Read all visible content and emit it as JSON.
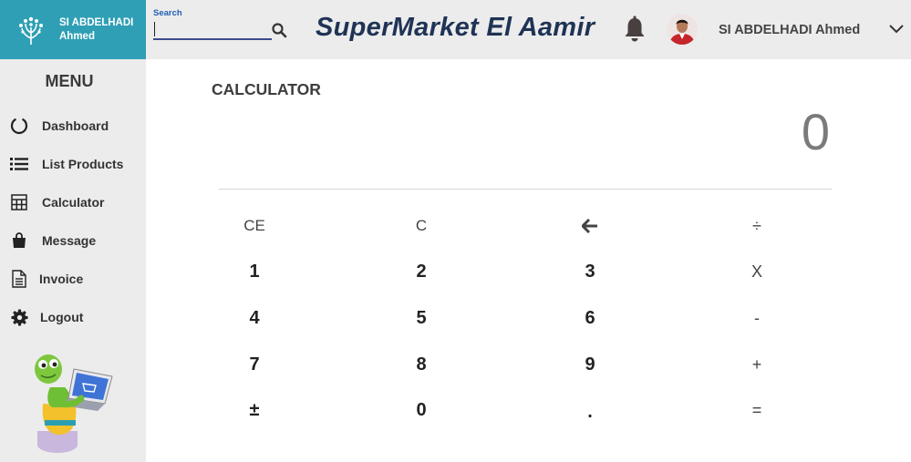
{
  "brand": {
    "user_line1": "SI ABDELHADI",
    "user_line2": "Ahmed",
    "color": "#2f9fb5"
  },
  "header": {
    "search_label": "Search",
    "search_value": "",
    "app_title": "SuperMarket El Aamir",
    "user_name": "SI ABDELHADI Ahmed",
    "icons": [
      "search-icon",
      "bell-icon",
      "chevron-down-icon"
    ]
  },
  "sidebar": {
    "title": "MENU",
    "items": [
      {
        "label": "Dashboard",
        "icon": "circle-icon"
      },
      {
        "label": "List Products",
        "icon": "list-icon"
      },
      {
        "label": "Calculator",
        "icon": "calculator-icon"
      },
      {
        "label": "Message",
        "icon": "bag-icon"
      },
      {
        "label": "Invoice",
        "icon": "document-icon"
      },
      {
        "label": "Logout",
        "icon": "gear-icon"
      }
    ]
  },
  "calculator": {
    "title": "CALCULATOR",
    "display": "0",
    "keys": [
      [
        "CE",
        "C",
        "←",
        "÷"
      ],
      [
        "1",
        "2",
        "3",
        "X"
      ],
      [
        "4",
        "5",
        "6",
        "-"
      ],
      [
        "7",
        "8",
        "9",
        "+"
      ],
      [
        "±",
        "0",
        ".",
        "="
      ]
    ]
  }
}
